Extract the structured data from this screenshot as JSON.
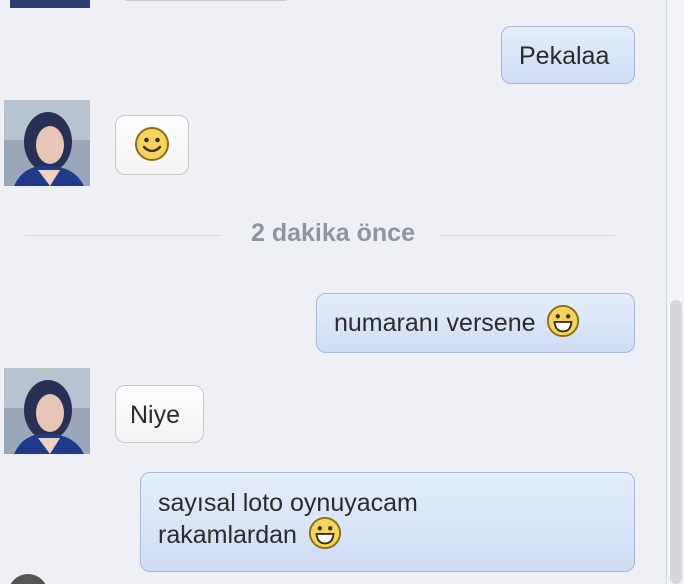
{
  "messages": [
    {
      "id": "m1",
      "side": "out",
      "text": "Pekalaa",
      "emoji": null
    },
    {
      "id": "m2",
      "side": "in",
      "text": "",
      "emoji": "smiley-emoji"
    },
    {
      "id": "m3",
      "side": "out",
      "text": "numaranı versene",
      "emoji": "grin-emoji"
    },
    {
      "id": "m4",
      "side": "in",
      "text": "Niye",
      "emoji": null
    },
    {
      "id": "m5",
      "side": "out",
      "text_line1": "sayısal loto oynuyacam",
      "text_line2": "rakamlardan",
      "emoji": "grin-emoji"
    }
  ],
  "time_separator": "2 dakika önce",
  "colors": {
    "background": "#eef0f6",
    "outgoing_bubble": "#dbe5f7",
    "outgoing_border": "#a9b8d4",
    "incoming_bubble": "#ffffff",
    "incoming_border": "#c9c9c9",
    "timestamp_text": "#8f949d"
  }
}
